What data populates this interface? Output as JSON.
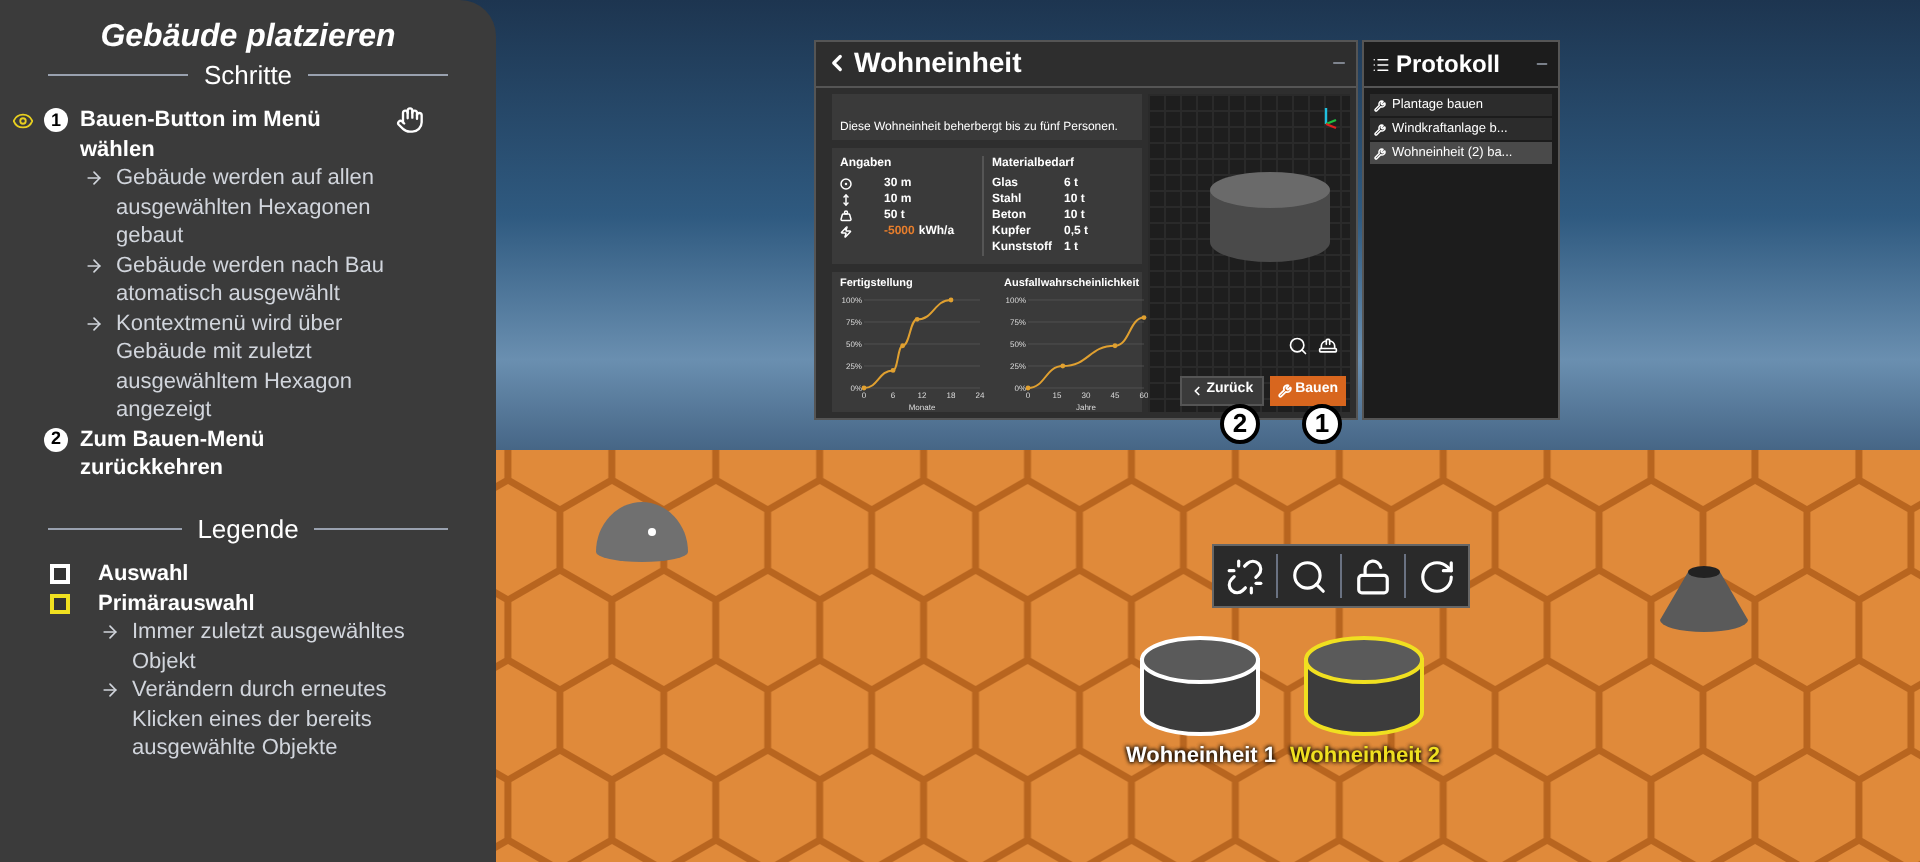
{
  "sidebar": {
    "title": "Gebäude platzieren",
    "steps_heading": "Schritte",
    "steps": [
      {
        "number": "1",
        "label": "Bauen-Button im Menü wählen",
        "active": true,
        "substeps": [
          "Gebäude werden auf allen ausgewählten Hexagonen gebaut",
          "Gebäude werden nach Bau atomatisch ausgewählt",
          "Kontextmenü wird über Gebäude mit zuletzt ausgewähltem Hexagon angezeigt"
        ]
      },
      {
        "number": "2",
        "label": "Zum Bauen-Menü zurückkehren",
        "active": false
      }
    ],
    "legend_heading": "Legende",
    "legend": [
      {
        "label": "Auswahl",
        "color": "#ffffff"
      },
      {
        "label": "Primärauswahl",
        "color": "#f0e020",
        "notes": [
          "Immer zuletzt ausgewähltes Objekt",
          "Verändern durch erneutes Klicken eines der bereits ausgewählte Objekte"
        ]
      }
    ]
  },
  "dialog": {
    "title": "Wohneinheit",
    "description": "Diese Wohneinheit beherbergt bis zu fünf Personen.",
    "specs_heading": "Angaben",
    "specs": [
      {
        "kind": "diameter",
        "value": "30 m",
        "negative": false
      },
      {
        "kind": "height",
        "value": "10 m",
        "negative": false
      },
      {
        "kind": "weight",
        "value": "50 t",
        "negative": false
      },
      {
        "kind": "energy",
        "value": "-5000",
        "unit": "kWh/a",
        "negative": true
      }
    ],
    "materials_heading": "Materialbedarf",
    "materials": [
      {
        "name": "Glas",
        "amount": "6 t"
      },
      {
        "name": "Stahl",
        "amount": "10 t"
      },
      {
        "name": "Beton",
        "amount": "10 t"
      },
      {
        "name": "Kupfer",
        "amount": "0,5 t"
      },
      {
        "name": "Kunststoff",
        "amount": "1 t"
      }
    ],
    "charts": [
      {
        "chart_data": {
          "type": "line",
          "title": "Fertigstellung",
          "xlabel": "Monate",
          "x": [
            0,
            6,
            8,
            11,
            18
          ],
          "grid": true,
          "series": [
            {
              "color": "#e0a030",
              "values": [
                0,
                20,
                48,
                78,
                100
              ]
            }
          ],
          "xlim": [
            0,
            24
          ],
          "ylim": [
            0,
            100
          ],
          "xticks": [
            0,
            6,
            12,
            18,
            24
          ],
          "yticks": [
            {
              "value": 0,
              "label": "0%"
            },
            {
              "value": 25,
              "label": "25%"
            },
            {
              "value": 50,
              "label": "50%"
            },
            {
              "value": 75,
              "label": "75%"
            },
            {
              "value": 100,
              "label": "100%"
            }
          ]
        }
      },
      {
        "chart_data": {
          "type": "line",
          "title": "Ausfallwahrscheinlichkeit",
          "xlabel": "Jahre",
          "x": [
            0,
            18,
            45,
            60
          ],
          "grid": true,
          "series": [
            {
              "color": "#e0a030",
              "values": [
                0,
                25,
                48,
                80
              ]
            }
          ],
          "xlim": [
            0,
            60
          ],
          "ylim": [
            0,
            100
          ],
          "xticks": [
            0,
            15,
            30,
            45,
            60
          ],
          "yticks": [
            {
              "value": 0,
              "label": "0%"
            },
            {
              "value": 25,
              "label": "25%"
            },
            {
              "value": 50,
              "label": "50%"
            },
            {
              "value": 75,
              "label": "75%"
            },
            {
              "value": 100,
              "label": "100%"
            }
          ]
        }
      }
    ],
    "back_button": "Zurück",
    "build_button": "Bauen",
    "markers": [
      "2",
      "1"
    ]
  },
  "protocol": {
    "title": "Protokoll",
    "items": [
      {
        "label": "Plantage bauen",
        "selected": false
      },
      {
        "label": "Windkraftanlage b...",
        "selected": false
      },
      {
        "label": "Wohneinheit (2) ba...",
        "selected": true
      }
    ]
  },
  "scene": {
    "buildings": [
      {
        "label": "Wohneinheit 1",
        "primary": false
      },
      {
        "label": "Wohneinheit 2",
        "primary": true
      }
    ]
  }
}
